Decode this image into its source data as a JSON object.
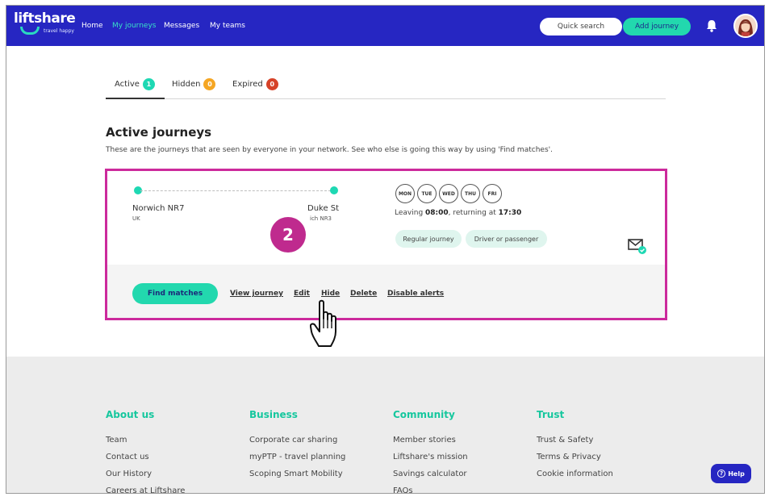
{
  "header": {
    "logo_text": "liftshare",
    "logo_tagline": "travel happy",
    "nav": [
      {
        "label": "Home"
      },
      {
        "label": "My journeys"
      },
      {
        "label": "Messages"
      },
      {
        "label": "My teams"
      }
    ],
    "quick_search": "Quick search",
    "add_journey": "Add journey"
  },
  "tabs": [
    {
      "label": "Active",
      "count": "1",
      "color": "#1ed8b3"
    },
    {
      "label": "Hidden",
      "count": "0",
      "color": "#f5a623"
    },
    {
      "label": "Expired",
      "count": "0",
      "color": "#d64228"
    }
  ],
  "section": {
    "title": "Active journeys",
    "description": "These are the journeys that are seen by everyone in your network. See who else is going this way by using 'Find matches'."
  },
  "journey": {
    "from_name": "Norwich NR7",
    "from_sub": "UK",
    "to_name": "Duke St",
    "to_sub": "ich NR3",
    "days": [
      "MON",
      "TUE",
      "WED",
      "THU",
      "FRI"
    ],
    "leaving_prefix": "Leaving ",
    "leaving_time": "08:00",
    "returning_prefix": ", returning at ",
    "returning_time": "17:30",
    "chips": [
      "Regular journey",
      "Driver or passenger"
    ],
    "step_number": "2",
    "find_matches": "Find matches",
    "actions": [
      "View journey",
      "Edit",
      "Hide",
      "Delete",
      "Disable alerts"
    ]
  },
  "footer": {
    "columns": [
      {
        "heading": "About us",
        "links": [
          "Team",
          "Contact us",
          "Our History",
          "Careers at Liftshare"
        ]
      },
      {
        "heading": "Business",
        "links": [
          "Corporate car sharing",
          "myPTP - travel planning",
          "Scoping Smart Mobility"
        ]
      },
      {
        "heading": "Community",
        "links": [
          "Member stories",
          "Liftshare's mission",
          "Savings calculator",
          "FAQs"
        ]
      },
      {
        "heading": "Trust",
        "links": [
          "Trust & Safety",
          "Terms & Privacy",
          "Cookie information"
        ]
      }
    ],
    "help": "Help"
  },
  "colors": {
    "brand_blue": "#2626c2",
    "accent_green": "#22d8ae",
    "highlight_magenta": "#cc2a9c"
  },
  "icons": [
    "bell-icon",
    "avatar",
    "mail-check-icon",
    "pointer-hand-cursor-icon",
    "help-question-icon"
  ]
}
